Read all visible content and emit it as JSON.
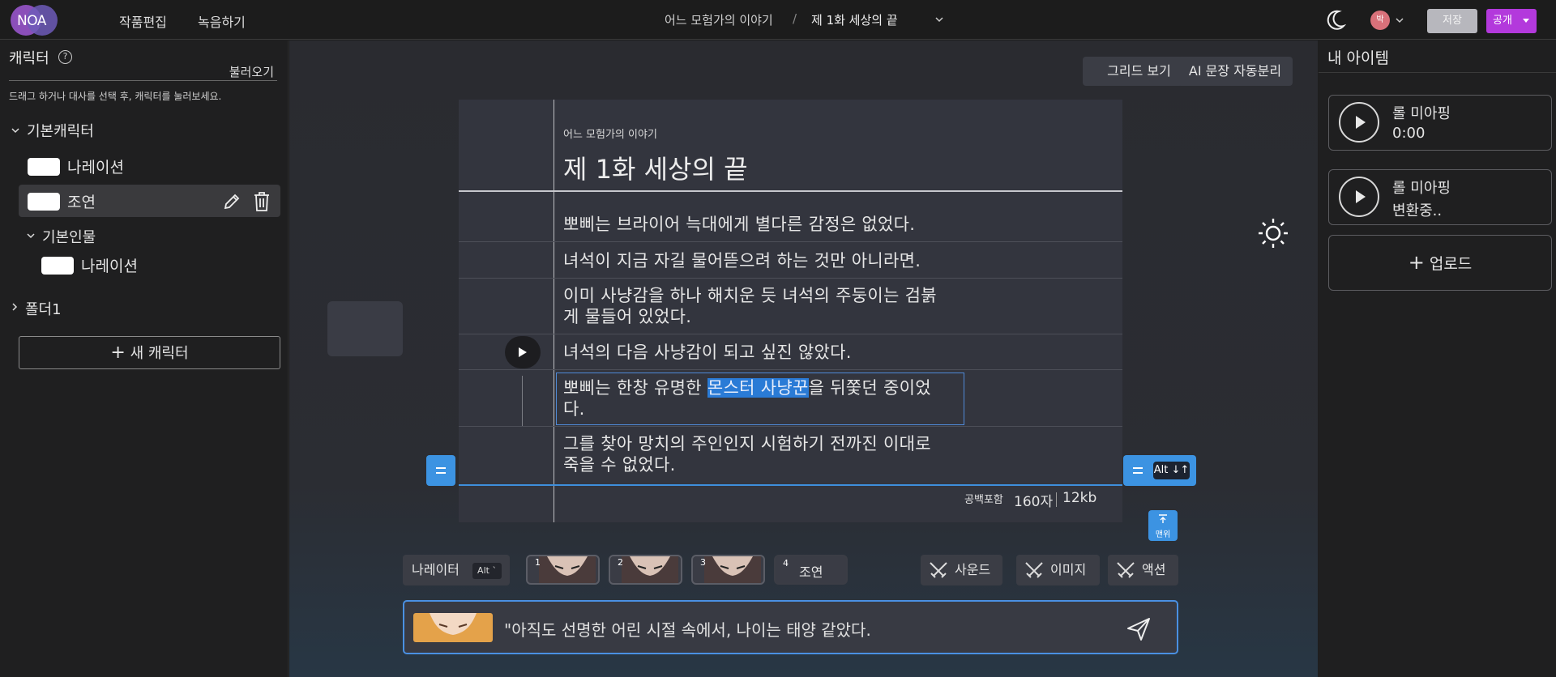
{
  "topbar": {
    "logo_text": "NOA",
    "nav": [
      "작품편집",
      "녹음하기"
    ],
    "breadcrumb": {
      "work": "어느 모험가의 이야기",
      "separator": "/",
      "episode": "제 1화 세상의 끝"
    },
    "avatar_text": "박",
    "save_label": "저장",
    "publish_label": "공개"
  },
  "left": {
    "title": "캐릭터",
    "import_label": "불러오기",
    "hint": "드래그 하거나 대사를 선택 후, 캐릭터를 눌러보세요.",
    "group1": "기본캐릭터",
    "items": [
      "나레이션",
      "조연"
    ],
    "subgroup": "기본인물",
    "subitems": [
      "나레이션"
    ],
    "folder": "폴더1",
    "new_character": "새 캐릭터"
  },
  "center": {
    "grid_view": "그리드 보기",
    "ai_split": "AI 문장 자동분리",
    "doc_subtitle": "어느 모험가의 이야기",
    "doc_title": "제 1화 세상의 끝",
    "lines": [
      "뽀삐는 브라이어 늑대에게 별다른 감정은 없었다.",
      "녀석이 지금 자길 물어뜯으려 하는 것만 아니라면.",
      "이미 사냥감을 하나 해치운 듯 녀석의 주둥이는 검붉게 물들어 있었다.",
      "녀석의 다음 사냥감이 되고 싶진 않았다.",
      "그를 찾아 망치의 주인인지 시험하기 전까진 이대로 죽을 수 없었다."
    ],
    "selected_line": {
      "before": "뽀삐는 한창 유명한 ",
      "highlight": "몬스터 사냥꾼",
      "after": "을 뒤쫓던 중이었다."
    },
    "count_label": "공백포함",
    "char_count": "160자",
    "size": "12kb",
    "alt_hint": "Alt ↓↑",
    "to_top": "맨위",
    "narrator_label": "나레이터",
    "narrator_key": "Alt `",
    "portraits": [
      "1",
      "2",
      "3"
    ],
    "slot4_num": "4",
    "slot4_label": "조연",
    "sound": "사운드",
    "image": "이미지",
    "action": "액션",
    "input_text": "\"아직도 선명한 어린 시절 속에서, 나이는 태양 같았다."
  },
  "right": {
    "title": "내 아이템",
    "cards": [
      {
        "name": "롤 미아핑",
        "status": "0:00"
      },
      {
        "name": "롤 미아핑",
        "status": "변환중.."
      }
    ],
    "upload": "업로드"
  }
}
